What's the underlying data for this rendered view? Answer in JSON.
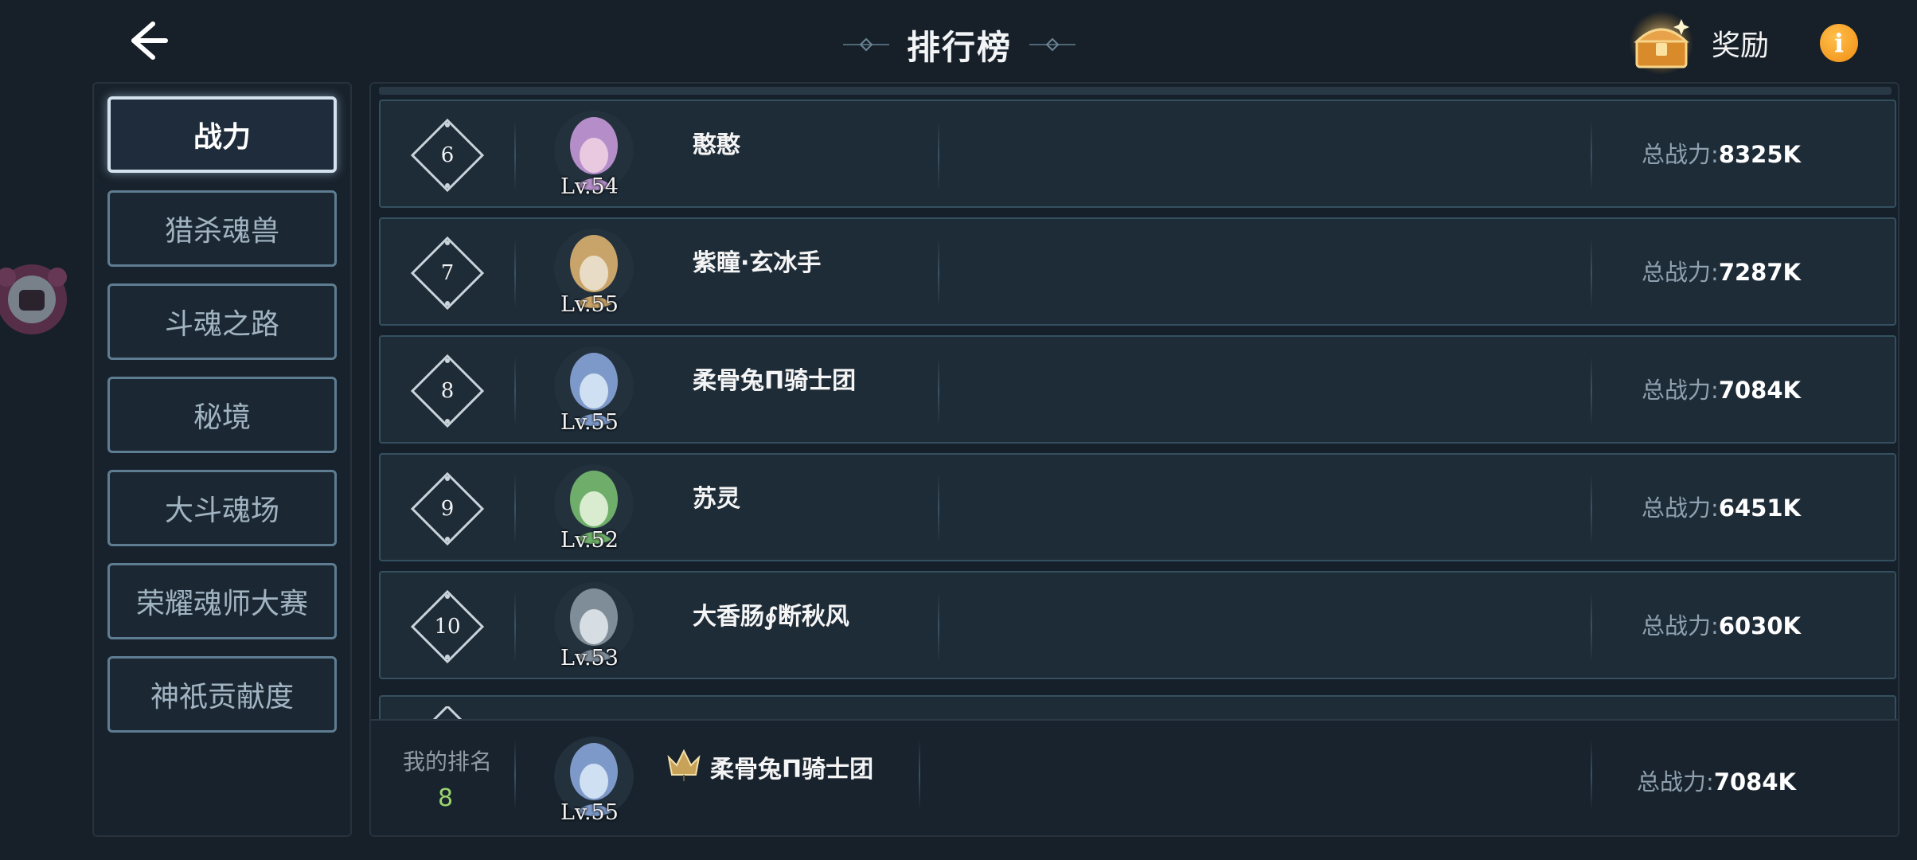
{
  "header": {
    "title": "排行榜",
    "reward_label": "奖励",
    "info_symbol": "i",
    "back_icon": "arrow-left-icon",
    "chest_icon": "treasure-chest-icon"
  },
  "sidebar": {
    "items": [
      {
        "label": "战力",
        "active": true
      },
      {
        "label": "猎杀魂兽",
        "active": false
      },
      {
        "label": "斗魂之路",
        "active": false
      },
      {
        "label": "秘境",
        "active": false
      },
      {
        "label": "大斗魂场",
        "active": false
      },
      {
        "label": "荣耀魂师大赛",
        "active": false
      },
      {
        "label": "神祇贡献度",
        "active": false
      }
    ]
  },
  "ranking": {
    "power_label": "总战力:",
    "rows": [
      {
        "rank": "6",
        "name": "憨憨",
        "level": "Lv.54",
        "power": "8325K",
        "avatar_colors": [
          "#b58ec9",
          "#e8c9e0"
        ]
      },
      {
        "rank": "7",
        "name": "紫瞳·玄冰手",
        "level": "Lv.55",
        "power": "7287K",
        "avatar_colors": [
          "#c9a46a",
          "#e9dcc6"
        ]
      },
      {
        "rank": "8",
        "name": "柔骨兔Π骑士团",
        "level": "Lv.55",
        "power": "7084K",
        "avatar_colors": [
          "#7d99c9",
          "#cfe0f2"
        ]
      },
      {
        "rank": "9",
        "name": "苏灵",
        "level": "Lv.52",
        "power": "6451K",
        "avatar_colors": [
          "#6fae6a",
          "#d9ecd0"
        ]
      },
      {
        "rank": "10",
        "name": "大香肠∮断秋风",
        "level": "Lv.53",
        "power": "6030K",
        "avatar_colors": [
          "#7f8d99",
          "#d6dde3"
        ]
      }
    ]
  },
  "my_rank": {
    "label": "我的排名",
    "value": "8",
    "name": "柔骨兔Π骑士团",
    "level": "Lv.55",
    "power_label": "总战力:",
    "power": "7084K",
    "avatar_colors": [
      "#7d99c9",
      "#cfe0f2"
    ]
  },
  "colors": {
    "background": "#172029",
    "row_background": "#1e2c38",
    "accent_gold": "#f0a020",
    "my_rank_green": "#9ad36e"
  }
}
